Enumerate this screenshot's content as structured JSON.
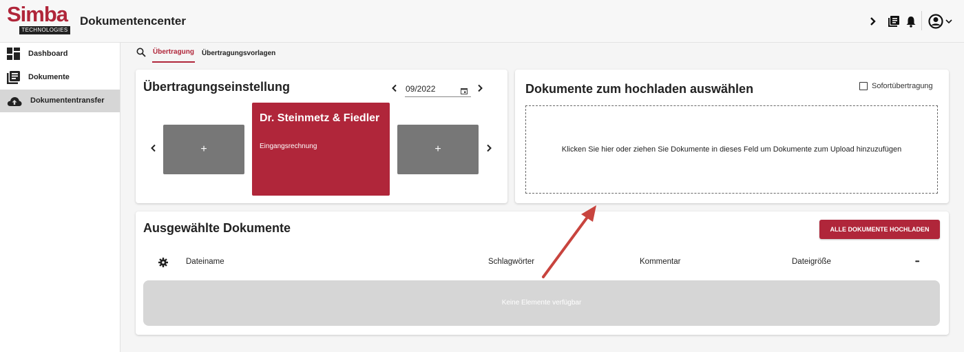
{
  "header": {
    "logo_text": "Simba",
    "logo_sub": "TECHNOLOGIES",
    "app_title": "Dokumentencenter",
    "icons": [
      "chevron-right-icon",
      "document-list-icon",
      "bell-icon",
      "account-icon",
      "chevron-down-icon"
    ]
  },
  "sidebar": {
    "items": [
      {
        "label": "Dashboard",
        "icon": "dashboard-icon"
      },
      {
        "label": "Dokumente",
        "icon": "document-icon"
      },
      {
        "label": "Dokumententransfer",
        "icon": "cloud-upload-icon",
        "active": true
      }
    ]
  },
  "tabs": {
    "search_icon": "search-icon",
    "items": [
      {
        "label": "Übertragung",
        "active": true
      },
      {
        "label": "Übertragungsvorlagen"
      }
    ]
  },
  "settings_card": {
    "title": "Übertragungseinstellung",
    "date_value": "09/2022",
    "tiles": [
      {
        "type": "add",
        "label": "+"
      },
      {
        "type": "selected",
        "name": "Dr. Steinmetz & Fiedler",
        "subtitle": "Eingangsrechnung"
      },
      {
        "type": "add",
        "label": "+"
      }
    ]
  },
  "upload_card": {
    "title": "Dokumente zum hochladen auswählen",
    "instant_label": "Sofortübertragung",
    "instant_checked": false,
    "drop_text": "Klicken Sie hier oder ziehen Sie Dokumente in dieses Feld um Dokumente zum Upload hinzuzufügen"
  },
  "selected_card": {
    "title": "Ausgewählte Dokumente",
    "upload_all_label": "ALLE DOKUMENTE HOCHLADEN",
    "columns": [
      "Dateiname",
      "Schlagwörter",
      "Kommentar",
      "Dateigröße"
    ],
    "more_label": "•••",
    "empty_text": "Keine Elemente verfügbar"
  },
  "colors": {
    "accent": "#b0263a",
    "tile_gray": "#777777",
    "active_nav": "#d6d6d6",
    "annotation_arrow": "#c8443e"
  }
}
